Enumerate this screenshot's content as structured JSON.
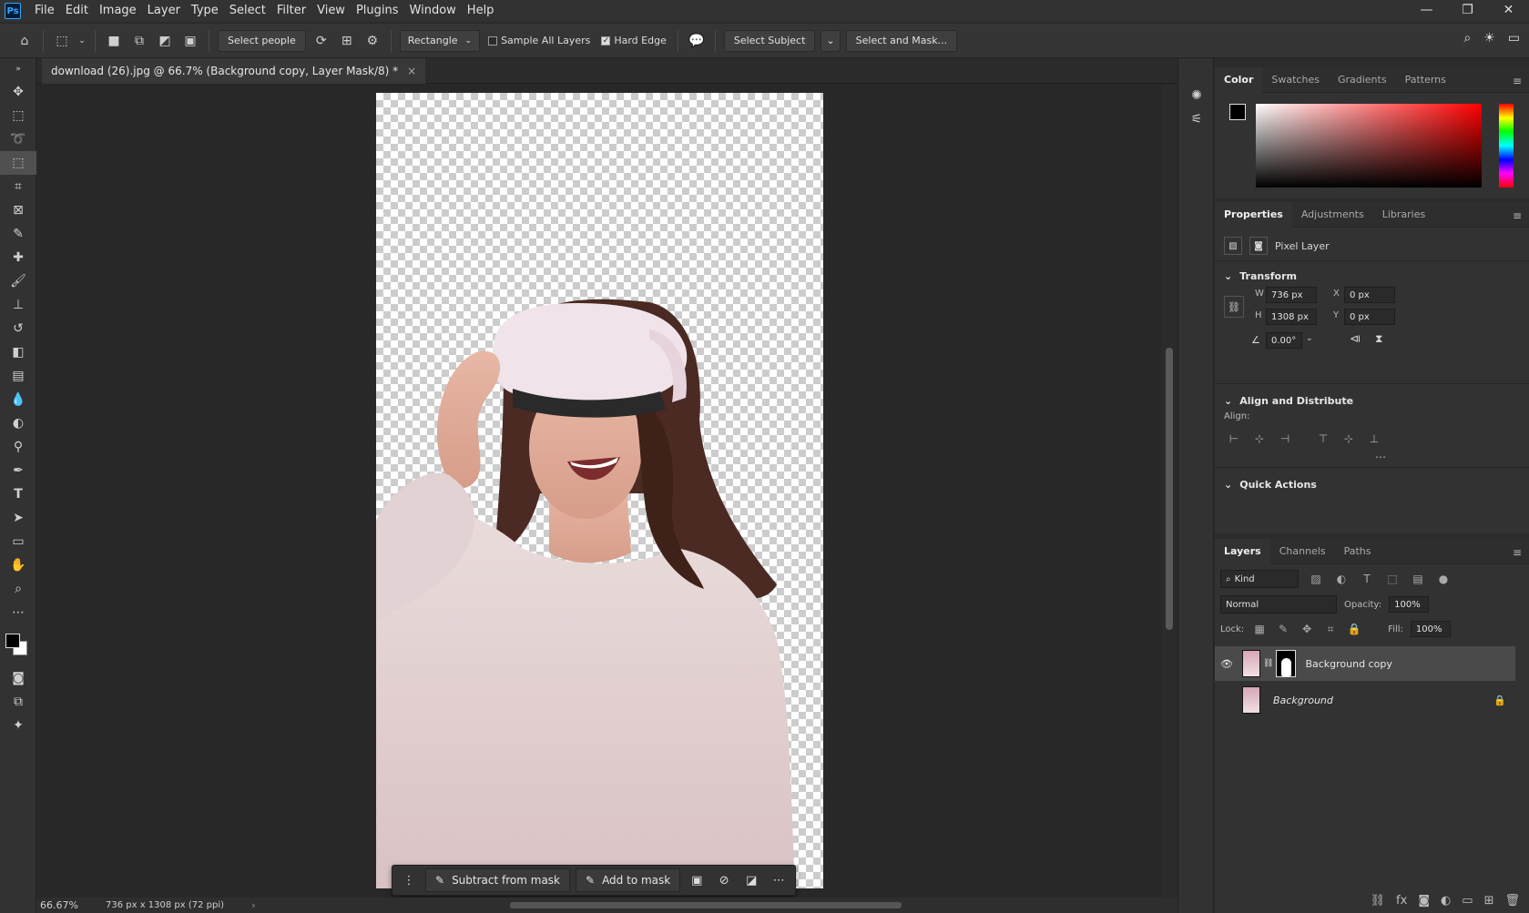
{
  "app": {
    "logo": "Ps"
  },
  "menu": [
    "File",
    "Edit",
    "Image",
    "Layer",
    "Type",
    "Select",
    "Filter",
    "View",
    "Plugins",
    "Window",
    "Help"
  ],
  "window_controls": [
    "—",
    "❐",
    "✕"
  ],
  "options_bar": {
    "select_people": "Select people",
    "mode": "Rectangle",
    "sample_all_layers": "Sample All Layers",
    "hard_edge": "Hard Edge",
    "select_subject": "Select Subject",
    "select_and_mask": "Select and Mask..."
  },
  "document": {
    "tab_title": "download (26).jpg @ 66.7% (Background copy, Layer Mask/8) *",
    "zoom": "66.67%",
    "info": "736 px x 1308 px (72 ppi)"
  },
  "context_bar": {
    "subtract": "Subtract from mask",
    "add": "Add to mask"
  },
  "color_panel": {
    "tabs": [
      "Color",
      "Swatches",
      "Gradients",
      "Patterns"
    ],
    "fg": "#000000",
    "bg": "#ffffff"
  },
  "properties": {
    "tabs": [
      "Properties",
      "Adjustments",
      "Libraries"
    ],
    "layer_type": "Pixel Layer",
    "transform_title": "Transform",
    "w_label": "W",
    "w": "736 px",
    "h_label": "H",
    "h": "1308 px",
    "x_label": "X",
    "x": "0 px",
    "y_label": "Y",
    "y": "0 px",
    "angle": "0.00°",
    "align_title": "Align and Distribute",
    "align_label": "Align:",
    "quick_actions": "Quick Actions"
  },
  "layers": {
    "tabs": [
      "Layers",
      "Channels",
      "Paths"
    ],
    "filter": "Kind",
    "blend": "Normal",
    "opacity_label": "Opacity:",
    "opacity": "100%",
    "lock_label": "Lock:",
    "fill_label": "Fill:",
    "fill": "100%",
    "items": [
      {
        "name": "Background copy"
      },
      {
        "name": "Background"
      }
    ]
  }
}
